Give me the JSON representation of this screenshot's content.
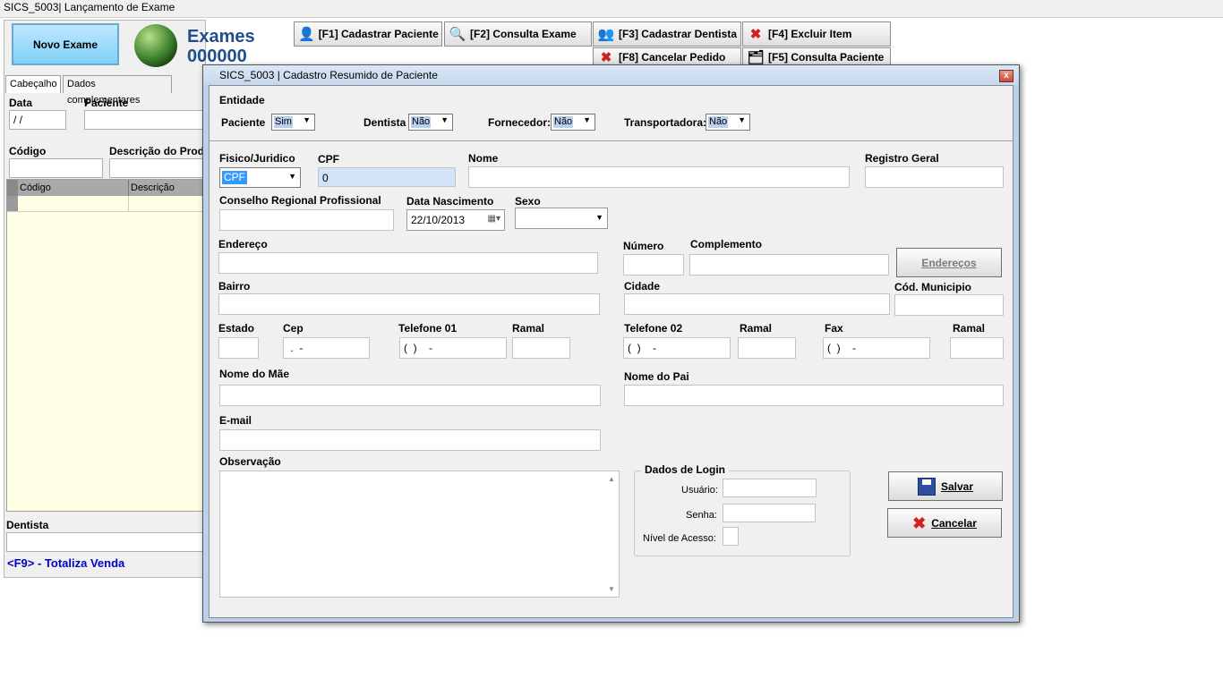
{
  "window": {
    "title": "SICS_5003| Lançamento de Exame"
  },
  "header": {
    "novo_exame": "Novo Exame",
    "exames_title": "Exames",
    "exames_number": "000000"
  },
  "toolbar": {
    "f1": "[F1] Cadastrar Paciente",
    "f2": "[F2] Consulta Exame",
    "f3": "[F3] Cadastrar Dentista",
    "f4": "[F4] Excluir Item",
    "f8": "[F8] Cancelar Pedido",
    "f5": "[F5] Consulta Paciente"
  },
  "tabs": [
    "Cabeçalho",
    "Dados complementares"
  ],
  "left": {
    "data_label": "Data",
    "data_value": " / /",
    "paciente_label": "Paciente",
    "codigo_label": "Código",
    "descricao_label": "Descrição do Produ",
    "grid_cols": [
      "Código",
      "Descrição"
    ],
    "dentista_label": "Dentista",
    "totaliza": "<F9> - Totaliza Venda"
  },
  "dialog": {
    "title": "SICS_5003 | Cadastro Resumido de Paciente",
    "close": "x",
    "entidade_label": "Entidade",
    "paciente_label": "Paciente",
    "paciente_value": "Sim",
    "dentista_label": "Dentista",
    "dentista_value": "Não",
    "fornecedor_label": "Fornecedor:",
    "fornecedor_value": "Não",
    "transportadora_label": "Transportadora:",
    "transportadora_value": "Não",
    "fisico_label": "Fisico/Juridico",
    "fisico_value": "CPF",
    "cpf_label": "CPF",
    "cpf_value": "0",
    "nome_label": "Nome",
    "rg_label": "Registro Geral",
    "conselho_label": "Conselho Regional Profissional",
    "nasc_label": "Data Nascimento",
    "nasc_value": "22/10/2013",
    "sexo_label": "Sexo",
    "endereco_label": "Endereço",
    "numero_label": "Número",
    "complemento_label": "Complemento",
    "enderecos_button": "Endereços",
    "bairro_label": "Bairro",
    "cidade_label": "Cidade",
    "cod_municipio_label": "Cód. Municipio",
    "estado_label": "Estado",
    "cep_label": "Cep",
    "cep_value": " .  -",
    "tel1_label": "Telefone 01",
    "tel1_value": "(  )    -",
    "ramal1_label": "Ramal",
    "tel2_label": "Telefone 02",
    "tel2_value": "(  )    -",
    "ramal2_label": "Ramal",
    "fax_label": "Fax",
    "fax_value": "(  )    -",
    "ramal3_label": "Ramal",
    "mae_label": "Nome do Mãe",
    "pai_label": "Nome do Pai",
    "email_label": "E-mail",
    "obs_label": "Observação",
    "login_group": "Dados de Login",
    "usuario_label": "Usuário:",
    "senha_label": "Senha:",
    "nivel_label": "Nível de Acesso:",
    "salvar": "Salvar",
    "cancelar": "Cancelar"
  }
}
